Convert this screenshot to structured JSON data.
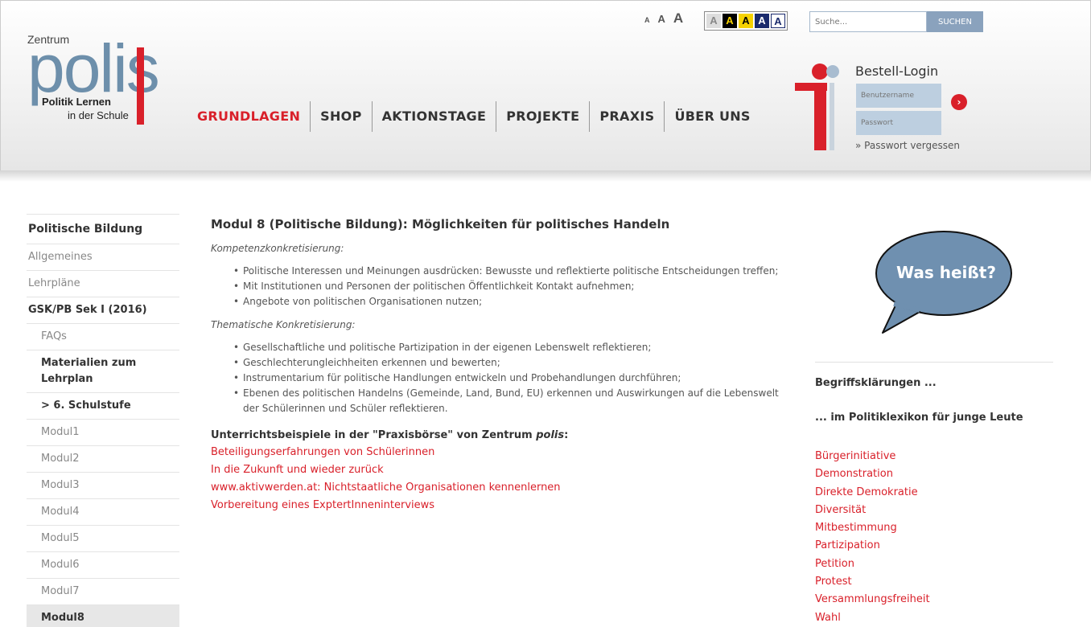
{
  "logo": {
    "zentrum": "Zentrum",
    "big": "polis",
    "line1": "Politik Lernen",
    "line2": "in der Schule"
  },
  "fontsizes": [
    "A",
    "A",
    "A"
  ],
  "contrast": [
    "A",
    "A",
    "A",
    "A",
    "A"
  ],
  "search": {
    "placeholder": "Suche...",
    "button": "SUCHEN"
  },
  "nav": [
    "GRUNDLAGEN",
    "SHOP",
    "AKTIONSTAGE",
    "PROJEKTE",
    "PRAXIS",
    "ÜBER UNS"
  ],
  "login": {
    "title": "Bestell-Login",
    "user_placeholder": "Benutzername",
    "pass_placeholder": "Passwort",
    "go": "›",
    "forgot": "» Passwort vergessen"
  },
  "sidebar": {
    "items": [
      {
        "label": "Politische Bildung"
      },
      {
        "label": "Allgemeines"
      },
      {
        "label": "Lehrpläne"
      },
      {
        "label": "GSK/PB Sek I (2016)"
      },
      {
        "label": "FAQs"
      },
      {
        "label": "Materialien zum Lehrplan"
      },
      {
        "label": "> 6. Schulstufe"
      },
      {
        "label": "Modul1"
      },
      {
        "label": "Modul2"
      },
      {
        "label": "Modul3"
      },
      {
        "label": "Modul4"
      },
      {
        "label": "Modul5"
      },
      {
        "label": "Modul6"
      },
      {
        "label": "Modul7"
      },
      {
        "label": "Modul8"
      }
    ]
  },
  "main": {
    "title": "Modul 8 (Politische Bildung): Möglichkeiten für politisches Handeln",
    "kompetenz_label": "Kompetenzkonkretisierung:",
    "kompetenz": [
      "Politische Interessen und Meinungen ausdrücken: Bewusste und reflektierte politische Entscheidungen treffen;",
      "Mit Institutionen und Personen der politischen Öffentlichkeit Kontakt aufnehmen;",
      "Angebote von politischen Organisationen nutzen;"
    ],
    "thematisch_label": "Thematische Konkretisierung:",
    "thematisch": [
      "Gesellschaftliche und politische Partizipation in der eigenen Lebenswelt reflektieren;",
      "Geschlechterungleichheiten erkennen und bewerten;",
      "Instrumentarium für politische Handlungen entwickeln und Probehandlungen durchführen;",
      "Ebenen des politischen Handelns (Gemeinde, Land, Bund, EU) erkennen und Auswirkungen auf die Lebenswelt der Schülerinnen und Schüler reflektieren."
    ],
    "examples_head_prefix": "Unterrichtsbeispiele in der \"Praxisbörse\" von Zentrum ",
    "examples_head_em": "polis",
    "examples_head_suffix": ":",
    "examples": [
      "Beteiligungserfahrungen von Schülerinnen",
      "In die Zukunft und wieder zurück",
      "www.aktivwerden.at: Nichtstaatliche Organisationen kennenlernen",
      "Vorbereitung eines ExptertInneninterviews"
    ]
  },
  "right": {
    "bubble": "Was heißt?",
    "heading1": "Begriffsklärungen ...",
    "heading2": "... im Politiklexikon für junge Leute",
    "terms": [
      "Bürgerinitiative",
      "Demonstration",
      "Direkte Demokratie",
      "Diversität",
      "Mitbestimmung",
      "Partizipation",
      "Petition",
      "Protest",
      "Versammlungsfreiheit",
      "Wahl"
    ]
  },
  "colors": {
    "accent": "#d9202a",
    "brand_blue": "#6d8fab",
    "bubble": "#6f90b0"
  }
}
